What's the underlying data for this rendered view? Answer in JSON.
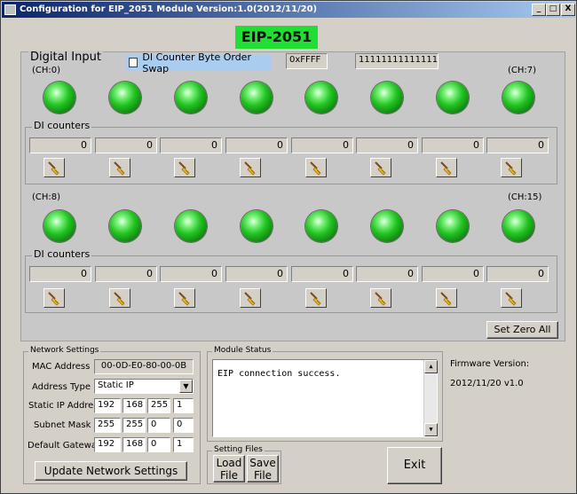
{
  "window": {
    "title": "Configuration for EIP_2051 Module Version:1.0(2012/11/20)",
    "min_symbol": "_",
    "max_symbol": "□",
    "close_symbol": "X"
  },
  "banner": "EIP-2051",
  "digital_input": {
    "title": "Digital Input",
    "byte_order_label": "DI Counter Byte Order Swap",
    "byte_order_checked": false,
    "hex_value": "0xFFFF",
    "bit_value": "1111111111111111",
    "row1_left": "(CH:0)",
    "row1_right": "(CH:7)",
    "row2_left": "(CH:8)",
    "row2_right": "(CH:15)",
    "counters_title_1": "DI counters",
    "counters_title_2": "DI counters",
    "counters": [
      "0",
      "0",
      "0",
      "0",
      "0",
      "0",
      "0",
      "0",
      "0",
      "0",
      "0",
      "0",
      "0",
      "0",
      "0",
      "0"
    ],
    "led_state": "on",
    "set_zero_all": "Set Zero All"
  },
  "network": {
    "title": "Network Settings",
    "mac_label": "MAC Address",
    "mac_value": "00-0D-E0-80-00-0B",
    "addr_type_label": "Address Type",
    "addr_type_value": "Static IP",
    "static_ip_label": "Static IP Address",
    "static_ip": [
      "192",
      "168",
      "255",
      "1"
    ],
    "subnet_label": "Subnet Mask",
    "subnet": [
      "255",
      "255",
      "0",
      "0"
    ],
    "gateway_label": "Default Gateway",
    "gateway": [
      "192",
      "168",
      "0",
      "1"
    ],
    "update_button": "Update Network Settings"
  },
  "module_status": {
    "title": "Module Status",
    "text": "EIP connection success."
  },
  "setting_files": {
    "title": "Setting Files",
    "load_line1": "Load",
    "load_line2": "File",
    "save_line1": "Save",
    "save_line2": "File"
  },
  "firmware": {
    "label": "Firmware Version:",
    "value": "2012/11/20 v1.0"
  },
  "exit_button": "Exit"
}
